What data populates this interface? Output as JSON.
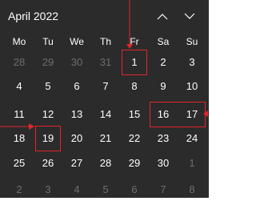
{
  "header": {
    "title": "April 2022",
    "prev_icon": "chevron-up-icon",
    "next_icon": "chevron-down-icon"
  },
  "weekdays": [
    "Mo",
    "Tu",
    "We",
    "Th",
    "Fr",
    "Sa",
    "Su"
  ],
  "weeks": [
    [
      {
        "d": "28",
        "out": true
      },
      {
        "d": "29",
        "out": true
      },
      {
        "d": "30",
        "out": true
      },
      {
        "d": "31",
        "out": true
      },
      {
        "d": "1",
        "out": false
      },
      {
        "d": "2",
        "out": false
      },
      {
        "d": "3",
        "out": false
      }
    ],
    [
      {
        "d": "4",
        "out": false
      },
      {
        "d": "5",
        "out": false
      },
      {
        "d": "6",
        "out": false
      },
      {
        "d": "7",
        "out": false
      },
      {
        "d": "8",
        "out": false
      },
      {
        "d": "9",
        "out": false
      },
      {
        "d": "10",
        "out": false
      }
    ],
    [
      {
        "d": "11",
        "out": false
      },
      {
        "d": "12",
        "out": false
      },
      {
        "d": "13",
        "out": false
      },
      {
        "d": "14",
        "out": false
      },
      {
        "d": "15",
        "out": false
      },
      {
        "d": "16",
        "out": false
      },
      {
        "d": "17",
        "out": false
      }
    ],
    [
      {
        "d": "18",
        "out": false
      },
      {
        "d": "19",
        "out": false
      },
      {
        "d": "20",
        "out": false
      },
      {
        "d": "21",
        "out": false
      },
      {
        "d": "22",
        "out": false
      },
      {
        "d": "23",
        "out": false
      },
      {
        "d": "24",
        "out": false
      }
    ],
    [
      {
        "d": "25",
        "out": false
      },
      {
        "d": "26",
        "out": false
      },
      {
        "d": "27",
        "out": false
      },
      {
        "d": "28",
        "out": false
      },
      {
        "d": "29",
        "out": false
      },
      {
        "d": "30",
        "out": false
      },
      {
        "d": "1",
        "out": true
      }
    ],
    [
      {
        "d": "2",
        "out": true
      },
      {
        "d": "3",
        "out": true
      },
      {
        "d": "4",
        "out": true
      },
      {
        "d": "5",
        "out": true
      },
      {
        "d": "6",
        "out": true
      },
      {
        "d": "7",
        "out": true
      },
      {
        "d": "8",
        "out": true
      }
    ]
  ],
  "colors": {
    "background": "#2b2b2b",
    "text": "#ffffff",
    "muted_text": "#6e6e6e",
    "annotation": "#e3252c"
  }
}
